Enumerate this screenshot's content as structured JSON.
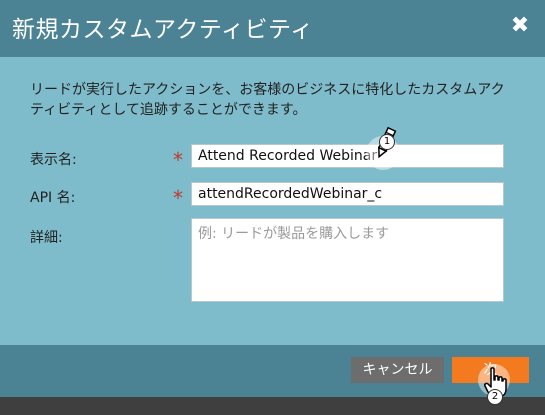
{
  "dialog": {
    "title": "新規カスタムアクティビティ",
    "close_icon": "close-icon",
    "description": "リードが実行したアクションを、お客様のビジネスに特化したカスタムアクティビティとして追跡することができます。"
  },
  "form": {
    "display_name": {
      "label": "表示名:",
      "value": "Attend Recorded Webinar",
      "required": true
    },
    "api_name": {
      "label": "API 名:",
      "value": "attendRecordedWebinar_c",
      "required": true
    },
    "details": {
      "label": "詳細:",
      "placeholder": "例: リードが製品を購入します",
      "value": ""
    }
  },
  "footer": {
    "cancel_label": "キャンセル",
    "next_label": "次"
  },
  "annotations": {
    "step1": "1",
    "step2": "2"
  },
  "colors": {
    "header": "#4b8394",
    "body": "#7fbccb",
    "next_button": "#f47a1f",
    "cancel_button": "#6d6d6d",
    "required": "#c0392b"
  }
}
